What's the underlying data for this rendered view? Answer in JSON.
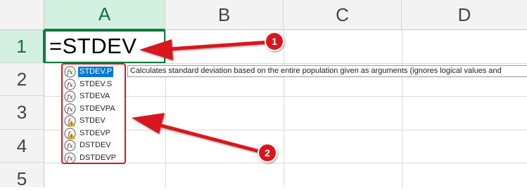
{
  "columns": [
    "A",
    "B",
    "C",
    "D"
  ],
  "rows": [
    "1",
    "2",
    "3",
    "4",
    "5"
  ],
  "active_cell": {
    "column": "A",
    "row": "1",
    "formula": "=STDEV"
  },
  "autocomplete": {
    "items": [
      {
        "label": "STDEV.P",
        "icon": "fx-function-icon",
        "selected": true
      },
      {
        "label": "STDEV.S",
        "icon": "fx-function-icon"
      },
      {
        "label": "STDEVA",
        "icon": "fx-function-icon"
      },
      {
        "label": "STDEVPA",
        "icon": "fx-function-icon"
      },
      {
        "label": "STDEV",
        "icon": "fx-compat-warning-icon"
      },
      {
        "label": "STDEVP",
        "icon": "fx-compat-warning-icon"
      },
      {
        "label": "DSTDEV",
        "icon": "fx-function-icon"
      },
      {
        "label": "DSTDEVP",
        "icon": "fx-function-icon"
      }
    ]
  },
  "tooltip": "Calculates standard deviation based on the entire population given as arguments (ignores logical values and",
  "annotations": {
    "callouts": [
      "1",
      "2"
    ],
    "color": "#d9161c"
  },
  "colors": {
    "selected_header": "#107c41",
    "selection": "#0078d4"
  }
}
